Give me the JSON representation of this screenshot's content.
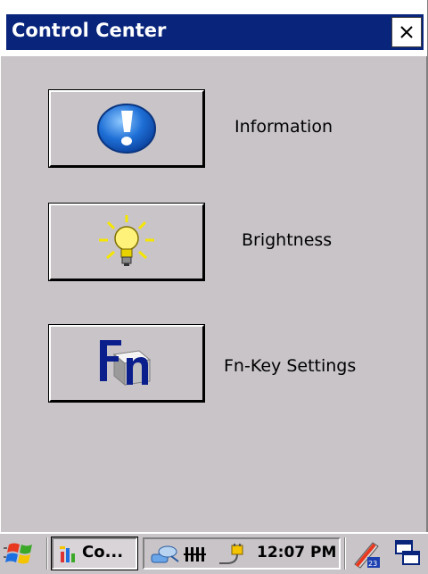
{
  "window": {
    "title": "Control Center",
    "close_label": "×"
  },
  "items": [
    {
      "label": "Information",
      "icon": "info-icon"
    },
    {
      "label": "Brightness",
      "icon": "lightbulb-icon"
    },
    {
      "label": "Fn-Key Settings",
      "icon": "fn-key-icon"
    }
  ],
  "taskbar": {
    "task_label": "Co...",
    "clock": "12:07 PM",
    "input_panel_badge": "23"
  },
  "colors": {
    "titlebar": "#08247b",
    "window_bg": "#c8c4c8",
    "info_blue": "#1e6fd6",
    "bulb_yellow": "#f5e600",
    "fn_blue": "#0a1e8c"
  }
}
